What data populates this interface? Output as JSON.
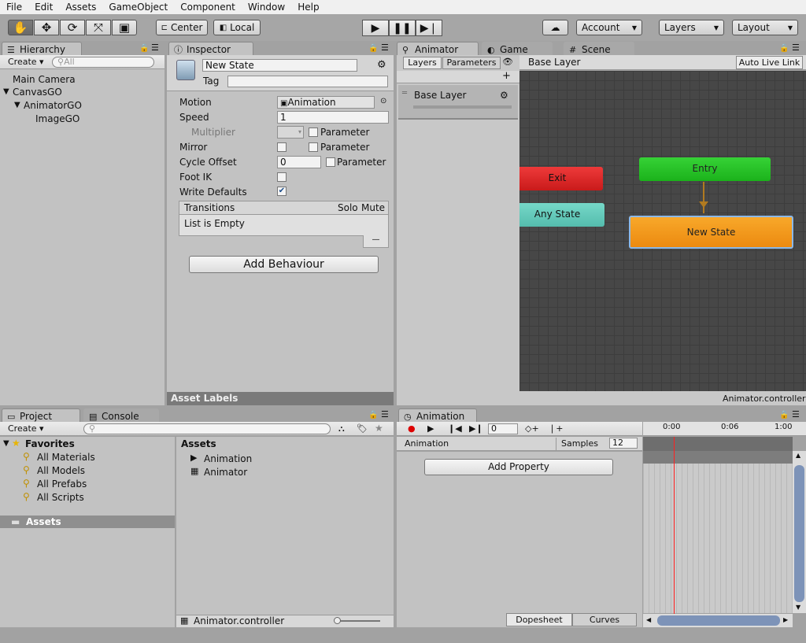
{
  "menu": [
    "File",
    "Edit",
    "Assets",
    "GameObject",
    "Component",
    "Window",
    "Help"
  ],
  "toolbar": {
    "pivot": "Center",
    "space": "Local",
    "account": "Account",
    "layers": "Layers",
    "layout": "Layout"
  },
  "hierarchy": {
    "tab": "Hierarchy",
    "create": "Create",
    "search_placeholder": "All",
    "items": [
      "Main Camera",
      "CanvasGO",
      "AnimatorGO",
      "ImageGO"
    ]
  },
  "inspector": {
    "tab": "Inspector",
    "name": "New State",
    "tag_label": "Tag",
    "motion_label": "Motion",
    "motion_value": "Animation",
    "speed_label": "Speed",
    "speed_value": "1",
    "multiplier_label": "Multiplier",
    "mirror_label": "Mirror",
    "cycle_offset_label": "Cycle Offset",
    "cycle_offset_value": "0",
    "foot_ik_label": "Foot IK",
    "write_defaults_label": "Write Defaults",
    "parameter_label": "Parameter",
    "transitions_header": "Transitions",
    "solo_label": "Solo",
    "mute_label": "Mute",
    "list_empty": "List is Empty",
    "remove_button": "—",
    "add_behaviour": "Add Behaviour",
    "asset_labels": "Asset Labels"
  },
  "animator": {
    "tab_animator": "Animator",
    "tab_game": "Game",
    "tab_scene": "Scene",
    "layers_tab": "Layers",
    "parameters_tab": "Parameters",
    "breadcrumb": "Base Layer",
    "auto_live_link": "Auto Live Link",
    "layer_name": "Base Layer",
    "add": "+",
    "nodes": {
      "entry": "Entry",
      "exit": "Exit",
      "any_state": "Any State",
      "new_state": "New State"
    },
    "footer": "Animator.controller",
    "colors": {
      "entry": "#22c422",
      "exit": "#d92222",
      "any_state": "#5fc8b8",
      "new_state": "#f39a1c"
    }
  },
  "project": {
    "tab_project": "Project",
    "tab_console": "Console",
    "create": "Create",
    "favorites_label": "Favorites",
    "favorites": [
      "All Materials",
      "All Models",
      "All Prefabs",
      "All Scripts"
    ],
    "assets_folder": "Assets",
    "assets_header": "Assets",
    "assets": [
      "Animation",
      "Animator"
    ],
    "footer_file": "Animator.controller"
  },
  "animation": {
    "tab": "Animation",
    "frame": "0",
    "clip": "Animation",
    "samples_label": "Samples",
    "samples_value": "12",
    "add_property": "Add Property",
    "dopesheet": "Dopesheet",
    "curves": "Curves",
    "timeline_labels": [
      "0:00",
      "0:06",
      "1:00"
    ]
  }
}
